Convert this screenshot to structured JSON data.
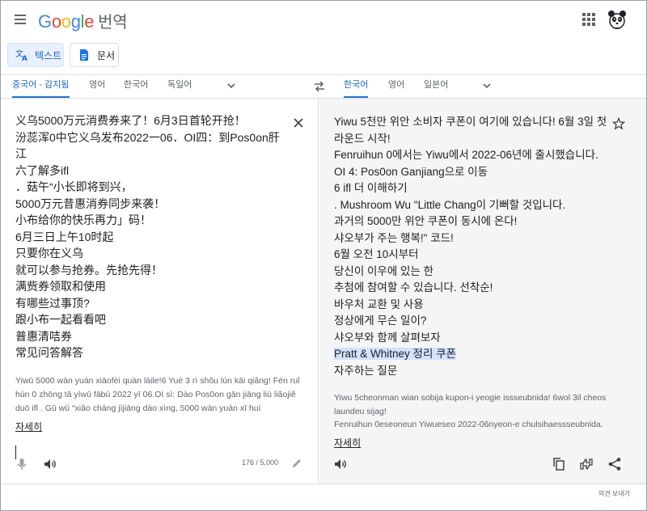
{
  "header": {
    "logo_text": "Google",
    "product_name": "번역",
    "logo_colors": [
      "#4285F4",
      "#EA4335",
      "#FBBC05",
      "#4285F4",
      "#34A853",
      "#EA4335"
    ],
    "menu_icon": "hamburger-menu-icon",
    "apps_icon": "apps-grid-icon",
    "avatar_icon": "panda-avatar-icon"
  },
  "toolbar": {
    "text_mode_label": "텍스트",
    "document_mode_label": "문서"
  },
  "source_languages": [
    "중국어 - 감지됨",
    "영어",
    "한국어",
    "독일어"
  ],
  "target_languages": [
    "한국어",
    "영어",
    "일본어"
  ],
  "source": {
    "lines": [
      "义乌5000万元消费券来了！6月3日首轮开抢！",
      "汾蕊浑0中它义乌发布2022一06．OI四：到Pos0on肝江",
      "六了解多ifl",
      "．菇午“小长即将到兴，",
      "5000万元昔惠消券同步来袭！",
      "小布给你的快乐再力」码！",
      "6月三日上午10时起",
      "只要你在义乌",
      "就可以参与抢券。先抢先得！",
      "满赀券领取和使用",
      "有哪些过事顶?",
      "跟小布一起看看吧",
      "普惠清咭券",
      "常见问答解答"
    ],
    "transliteration": "Yiwū 5000 wàn yuán xiāofèi quàn láile!6 Yuè 3 rì shǒu lún kāi qiǎng! Fén ruǐ hún 0 zhōng tā yìwū fābù 2022 yī 06.OI sì: Dào Pos0on gān jiāng liù liǎojiě duō ifl . Gū wǔ “xiǎo cháng jìjiāng dào xìng, 5000 wàn yuán xī huì",
    "more_label": "자세히",
    "char_count": "176 / 5,000"
  },
  "target": {
    "lines": [
      "Yiwu 5천만 위안 소비자 쿠폰이 여기에 있습니다! 6월 3일 첫 라운드 시작!",
      "Fenruihun 0에서는 Yiwu에서 2022-06년에 출시했습니다.",
      "OI 4: Pos0on Ganjiang으로 이동",
      "6 ifl 더 이해하기",
      ". Mushroom Wu \"Little Chang이 기뻐할 것입니다.",
      "과거의 5000만 위안 쿠폰이 동시에 온다!",
      "샤오부가 주는 행복!\" 코드!",
      "6월 오전 10시부터",
      "당신이 이우에 있는 한",
      "추첨에 참여할 수 있습니다. 선착순!",
      "바우처 교환 및 사용",
      "정상에게 무슨 일이?",
      "샤오부와 함께 살펴보자",
      "Pratt & Whitney 정리 쿠폰",
      "자주하는 질문"
    ],
    "highlighted_index": 13,
    "transliteration": [
      "Yiwu 5cheonman wian sobija kupon-i yeogie issseubnida! 6wol 3il cheos laundeu sijag!",
      "Fenruihun 0eseoneun Yiwueseo 2022-06nyeon-e chulsihaessseubnida."
    ],
    "more_label": "자세히"
  },
  "footer": {
    "feedback_label": "의견 보내기"
  },
  "colors": {
    "accent": "#1a73e8",
    "active_tab_text": "#1967d2",
    "active_mode_bg": "#e8f0fe",
    "border": "#dadce0",
    "secondary_text": "#5f6368",
    "target_panel_bg": "#f5f5f5",
    "highlight": "#d2e3fc"
  }
}
